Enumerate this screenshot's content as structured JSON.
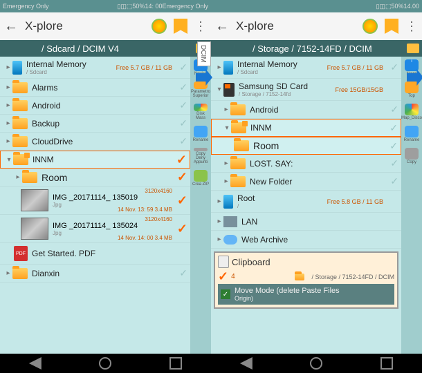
{
  "status": {
    "carrier": "Emergency Only",
    "battery": "50%",
    "time_left": "14: 00",
    "time_right": "14.00",
    "extra": "Emergency Only"
  },
  "app": {
    "title": "X-plore"
  },
  "left": {
    "breadcrumb": "/ Sdcard / DCIM V4",
    "internal": {
      "label": "Internal Memory",
      "path": "/ Sdcard",
      "free": "Free 5.7 GB / 11 GB"
    },
    "folders": {
      "alarms": "Alarms",
      "android": "Android",
      "backup": "Backup",
      "clouddrive": "CloudDrive",
      "innm": "INNM",
      "room": "Room",
      "dianxin": "Dianxin"
    },
    "files": {
      "img1": {
        "name": "IMG _20171114_ 135019",
        "ext": "Jpg",
        "dim": "3120x4160",
        "meta": "14 Nov. 13: 59 3.4 MB"
      },
      "img2": {
        "name": "IMG _20171114_ 135024",
        "ext": "Jpg",
        "dim": "3120x4160",
        "meta": "14 Nov. 14: 00 3.4 MB"
      },
      "pdf": {
        "name": "Get Started. PDF"
      }
    },
    "side": {
      "novice": "Novice",
      "para": "Parametro Superior",
      "disk": "Disk Mass",
      "rename": "Rename",
      "copy": "Copy Deny Appunti",
      "crea": "Crea ZIP"
    },
    "vert": "DCIM"
  },
  "right": {
    "breadcrumb": "/ Storage / 7152-14FD / DCIM",
    "internal": {
      "label": "Internal Memory",
      "path": "/ Sdcard",
      "free": "Free 5.7 GB / 11 GB"
    },
    "sd": {
      "label": "Samsung SD Card",
      "path": "/ Storage / 7152-14fd",
      "free": "Free 15GB/15GB"
    },
    "folders": {
      "android": "Android",
      "innm": "INNM",
      "room": "Room",
      "lostsay": "LOST. SAY:",
      "newfolder": "New Folder"
    },
    "root": {
      "label": "Root",
      "path": "/",
      "free": "Free 5.8 GB / 11 GB"
    },
    "lan": "LAN",
    "web": "Web Archive",
    "clipboard": {
      "title": "Clipboard",
      "count": "4",
      "path": "/ Storage / 7152-14FD / DCIM",
      "mode": "Move Mode (delete Paste Files",
      "origin": "Origin)"
    },
    "side": {
      "news": "News",
      "top": "Top",
      "map": "Map_Disco",
      "rename": "Rename",
      "copy": "Copy"
    }
  }
}
